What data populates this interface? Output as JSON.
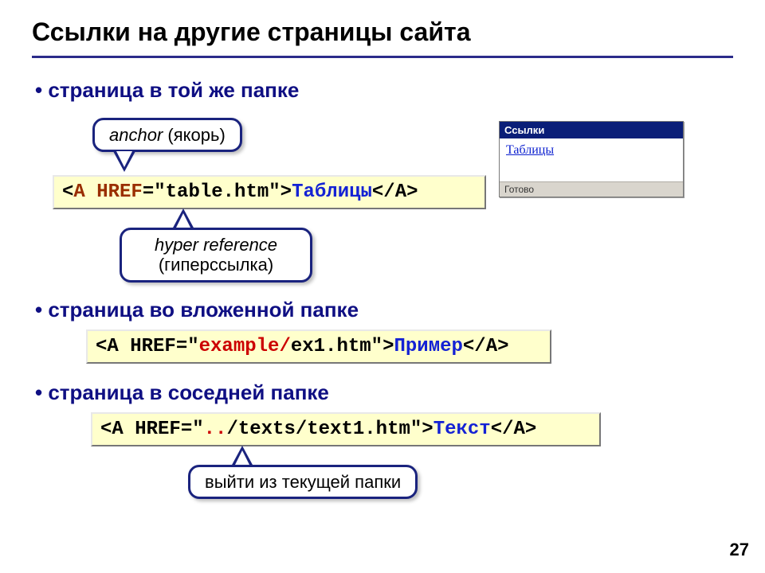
{
  "title": "Ссылки на другие страницы сайта",
  "page_number": "27",
  "bullets": {
    "b1": "страница в той же папке",
    "b2": "страница во вложенной папке",
    "b3": "страница в соседней папке"
  },
  "callouts": {
    "anchor_label_em": "anchor",
    "anchor_label_rest": " (якорь)",
    "href_label_em": "hyper reference",
    "href_label_rest": "(гиперссылка)",
    "updir_label": "выйти из текущей папки"
  },
  "code1": {
    "lt": "<",
    "A": "A",
    "sp1": " ",
    "HREF": "HREF",
    "eq": "=\"",
    "file": "table.htm",
    "q2": "\"",
    "gt": ">",
    "text": "Таблицы",
    "close": "</A>"
  },
  "code2": {
    "open": "<A HREF=\"",
    "dir": "example/",
    "file": "ex1.htm",
    "qgt": "\">",
    "text": "Пример",
    "close": "</A>"
  },
  "code3": {
    "open": "<A HREF=\"",
    "dots": "..",
    "rest": "/texts/text1.htm",
    "qgt": "\">",
    "text": "Текст",
    "close": "</A>"
  },
  "browser": {
    "title": "Ссылки",
    "link": "Таблицы",
    "status": "Готово"
  }
}
